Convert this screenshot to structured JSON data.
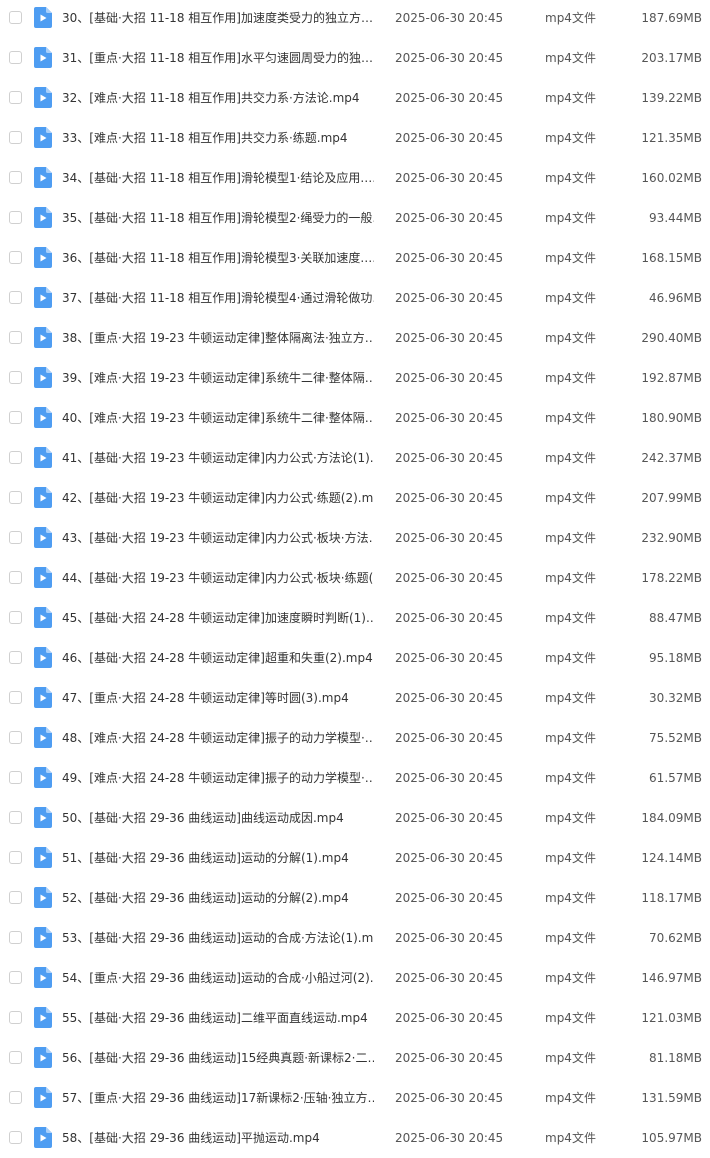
{
  "file_list": {
    "icon": "video-file-icon",
    "icon_color": "#4e9df2",
    "files": [
      {
        "name": "30、[基础·大招 11-18 相互作用]加速度类受力的独立方…",
        "date": "2025-06-30 20:45",
        "type": "mp4文件",
        "size": "187.69MB"
      },
      {
        "name": "31、[重点·大招 11-18 相互作用]水平匀速圆周受力的独…",
        "date": "2025-06-30 20:45",
        "type": "mp4文件",
        "size": "203.17MB"
      },
      {
        "name": "32、[难点·大招 11-18 相互作用]共交力系·方法论.mp4",
        "date": "2025-06-30 20:45",
        "type": "mp4文件",
        "size": "139.22MB"
      },
      {
        "name": "33、[难点·大招 11-18 相互作用]共交力系·练题.mp4",
        "date": "2025-06-30 20:45",
        "type": "mp4文件",
        "size": "121.35MB"
      },
      {
        "name": "34、[基础·大招 11-18 相互作用]滑轮模型1·结论及应用.…",
        "date": "2025-06-30 20:45",
        "type": "mp4文件",
        "size": "160.02MB"
      },
      {
        "name": "35、[基础·大招 11-18 相互作用]滑轮模型2·绳受力的一般…",
        "date": "2025-06-30 20:45",
        "type": "mp4文件",
        "size": "93.44MB"
      },
      {
        "name": "36、[基础·大招 11-18 相互作用]滑轮模型3·关联加速度.…",
        "date": "2025-06-30 20:45",
        "type": "mp4文件",
        "size": "168.15MB"
      },
      {
        "name": "37、[基础·大招 11-18 相互作用]滑轮模型4·通过滑轮做功…",
        "date": "2025-06-30 20:45",
        "type": "mp4文件",
        "size": "46.96MB"
      },
      {
        "name": "38、[重点·大招 19-23 牛顿运动定律]整体隔离法·独立方…",
        "date": "2025-06-30 20:45",
        "type": "mp4文件",
        "size": "290.40MB"
      },
      {
        "name": "39、[难点·大招 19-23 牛顿运动定律]系统牛二律·整体隔…",
        "date": "2025-06-30 20:45",
        "type": "mp4文件",
        "size": "192.87MB"
      },
      {
        "name": "40、[难点·大招 19-23 牛顿运动定律]系统牛二律·整体隔…",
        "date": "2025-06-30 20:45",
        "type": "mp4文件",
        "size": "180.90MB"
      },
      {
        "name": "41、[基础·大招 19-23 牛顿运动定律]内力公式·方法论(1).…",
        "date": "2025-06-30 20:45",
        "type": "mp4文件",
        "size": "242.37MB"
      },
      {
        "name": "42、[基础·大招 19-23 牛顿运动定律]内力公式·练题(2).m…",
        "date": "2025-06-30 20:45",
        "type": "mp4文件",
        "size": "207.99MB"
      },
      {
        "name": "43、[基础·大招 19-23 牛顿运动定律]内力公式·板块·方法…",
        "date": "2025-06-30 20:45",
        "type": "mp4文件",
        "size": "232.90MB"
      },
      {
        "name": "44、[基础·大招 19-23 牛顿运动定律]内力公式·板块·练题(…",
        "date": "2025-06-30 20:45",
        "type": "mp4文件",
        "size": "178.22MB"
      },
      {
        "name": "45、[基础·大招 24-28 牛顿运动定律]加速度瞬时判断(1).…",
        "date": "2025-06-30 20:45",
        "type": "mp4文件",
        "size": "88.47MB"
      },
      {
        "name": "46、[基础·大招 24-28 牛顿运动定律]超重和失重(2).mp4",
        "date": "2025-06-30 20:45",
        "type": "mp4文件",
        "size": "95.18MB"
      },
      {
        "name": "47、[重点·大招 24-28 牛顿运动定律]等时圆(3).mp4",
        "date": "2025-06-30 20:45",
        "type": "mp4文件",
        "size": "30.32MB"
      },
      {
        "name": "48、[难点·大招 24-28 牛顿运动定律]振子的动力学模型·…",
        "date": "2025-06-30 20:45",
        "type": "mp4文件",
        "size": "75.52MB"
      },
      {
        "name": "49、[难点·大招 24-28 牛顿运动定律]振子的动力学模型·…",
        "date": "2025-06-30 20:45",
        "type": "mp4文件",
        "size": "61.57MB"
      },
      {
        "name": "50、[基础·大招 29-36 曲线运动]曲线运动成因.mp4",
        "date": "2025-06-30 20:45",
        "type": "mp4文件",
        "size": "184.09MB"
      },
      {
        "name": "51、[基础·大招 29-36 曲线运动]运动的分解(1).mp4",
        "date": "2025-06-30 20:45",
        "type": "mp4文件",
        "size": "124.14MB"
      },
      {
        "name": "52、[基础·大招 29-36 曲线运动]运动的分解(2).mp4",
        "date": "2025-06-30 20:45",
        "type": "mp4文件",
        "size": "118.17MB"
      },
      {
        "name": "53、[基础·大招 29-36 曲线运动]运动的合成·方法论(1).m…",
        "date": "2025-06-30 20:45",
        "type": "mp4文件",
        "size": "70.62MB"
      },
      {
        "name": "54、[重点·大招 29-36 曲线运动]运动的合成·小船过河(2).…",
        "date": "2025-06-30 20:45",
        "type": "mp4文件",
        "size": "146.97MB"
      },
      {
        "name": "55、[基础·大招 29-36 曲线运动]二维平面直线运动.mp4",
        "date": "2025-06-30 20:45",
        "type": "mp4文件",
        "size": "121.03MB"
      },
      {
        "name": "56、[基础·大招 29-36 曲线运动]15经典真题·新课标2·二…",
        "date": "2025-06-30 20:45",
        "type": "mp4文件",
        "size": "81.18MB"
      },
      {
        "name": "57、[重点·大招 29-36 曲线运动]17新课标2·压轴·独立方…",
        "date": "2025-06-30 20:45",
        "type": "mp4文件",
        "size": "131.59MB"
      },
      {
        "name": "58、[基础·大招 29-36 曲线运动]平抛运动.mp4",
        "date": "2025-06-30 20:45",
        "type": "mp4文件",
        "size": "105.97MB"
      }
    ]
  }
}
